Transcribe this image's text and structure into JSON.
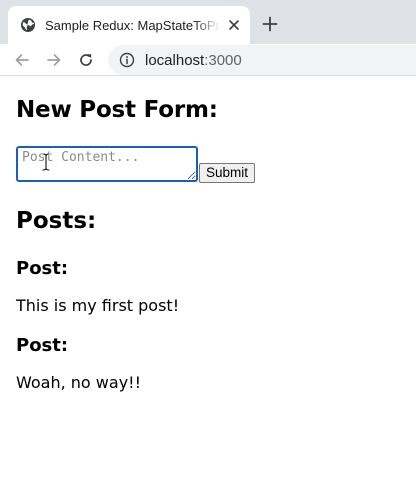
{
  "browser": {
    "tab": {
      "title": "Sample Redux: MapStateToProps",
      "favicon": "globe-icon",
      "close_icon": "close-icon"
    },
    "new_tab_icon": "plus-icon",
    "toolbar": {
      "back_icon": "arrow-left-icon",
      "forward_icon": "arrow-right-icon",
      "reload_icon": "reload-icon",
      "site_info_icon": "info-icon",
      "url_host": "localhost",
      "url_port": ":3000"
    },
    "colors": {
      "tab_strip_bg": "#dee1e6",
      "omnibox_bg": "#f1f3f4",
      "focus_ring": "#1a5fbf"
    }
  },
  "page": {
    "form_heading": "New Post Form:",
    "textarea": {
      "placeholder": "Post Content...",
      "value": ""
    },
    "submit_label": "Submit",
    "posts_heading": "Posts:",
    "posts": [
      {
        "label": "Post:",
        "content": "This is my first post!"
      },
      {
        "label": "Post:",
        "content": "Woah, no way!!"
      }
    ],
    "cursor_icon": "text-cursor-icon"
  }
}
